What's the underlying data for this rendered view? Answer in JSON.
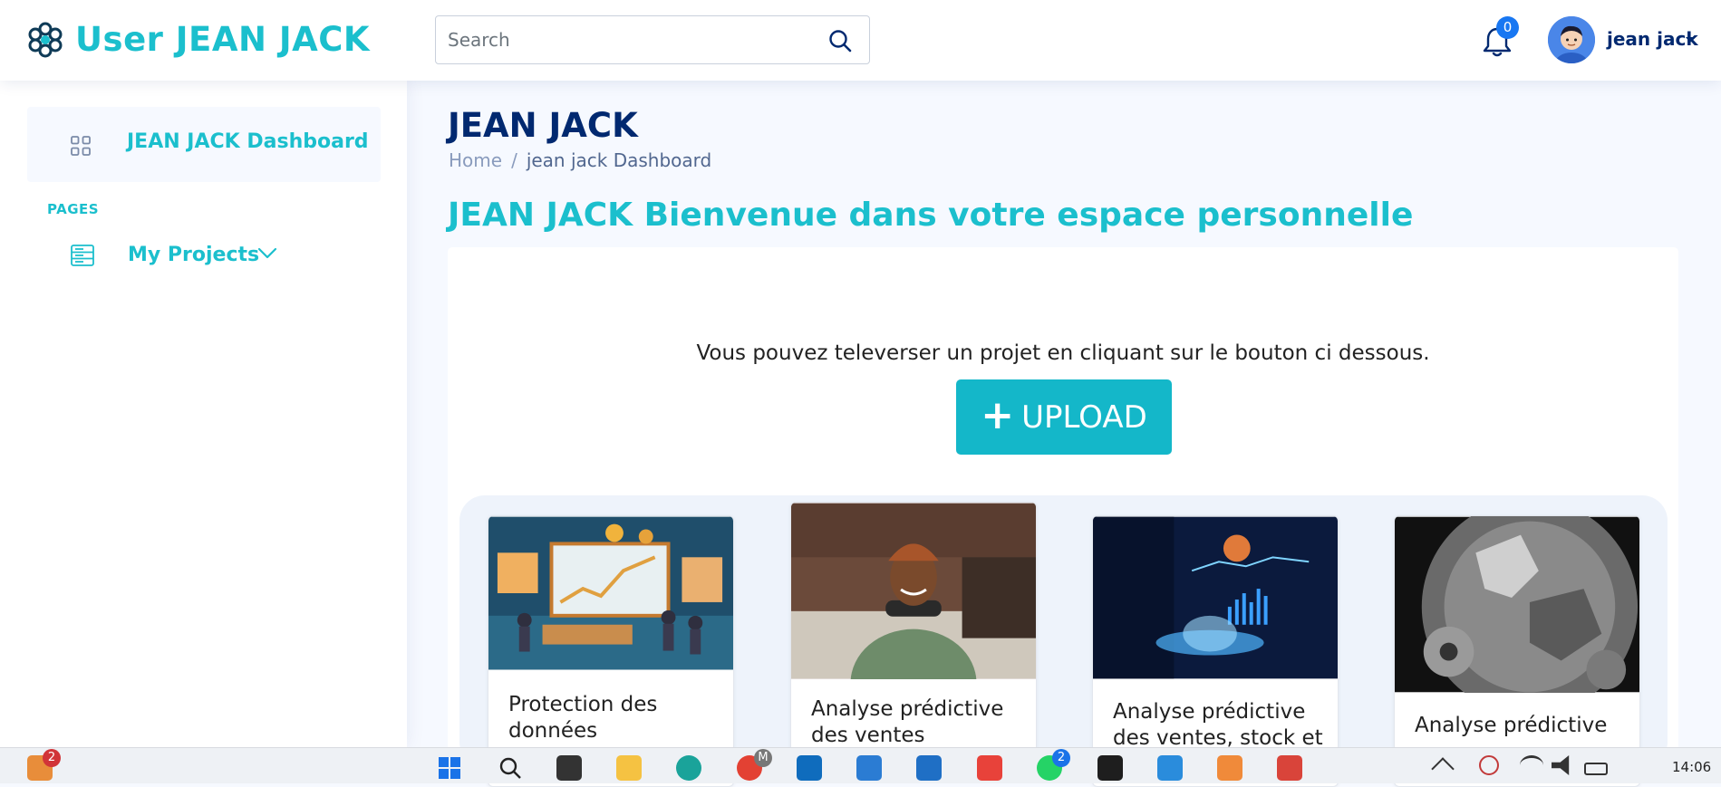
{
  "header": {
    "logo_text": "User JEAN JACK",
    "search_placeholder": "Search",
    "notifications_count": "0",
    "user_name": "jean jack"
  },
  "sidebar": {
    "dashboard_label": "JEAN JACK Dashboard",
    "section_heading": "PAGES",
    "projects_label": "My Projects"
  },
  "main": {
    "page_title": "JEAN JACK",
    "breadcrumb": {
      "home": "Home",
      "separator": "/",
      "current": "jean jack Dashboard"
    },
    "welcome": "JEAN JACK Bienvenue dans votre espace personnelle",
    "intro": "Vous pouvez televerser un projet en cliquant sur le bouton ci dessous.",
    "upload_label": "UPLOAD",
    "projects": [
      {
        "title": "Protection des données"
      },
      {
        "title": "Analyse prédictive des ventes"
      },
      {
        "title": "Analyse prédictive des ventes, stock et"
      },
      {
        "title": "Analyse prédictive"
      }
    ]
  },
  "taskbar": {
    "weather_badge": "2",
    "whatsapp_badge": "2",
    "chrome_profile": "M",
    "clock": "14:06"
  },
  "colors": {
    "accent": "#1bbfcd",
    "navy": "#012970",
    "upload_bg": "#14b7c9"
  }
}
